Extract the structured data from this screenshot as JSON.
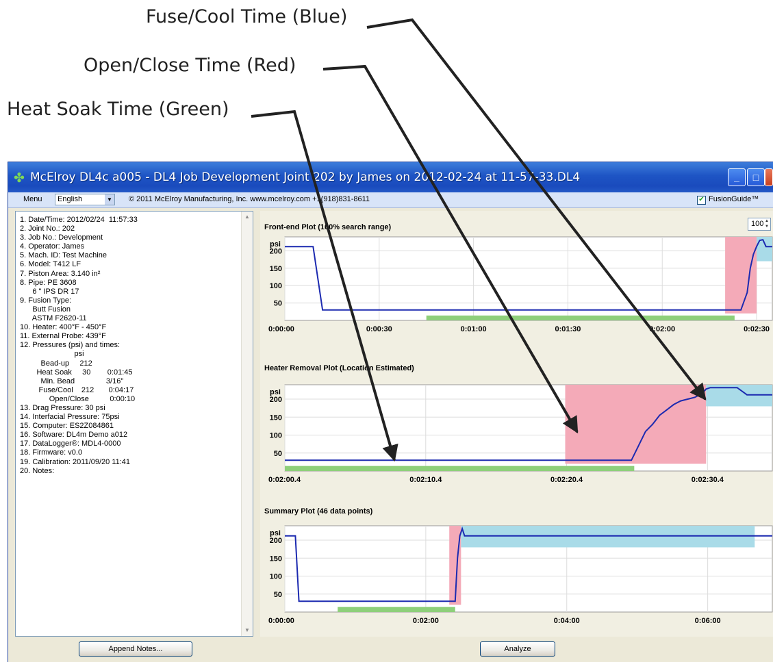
{
  "annotations": {
    "fuse_cool": "Fuse/Cool Time (Blue)",
    "open_close": "Open/Close Time (Red)",
    "heat_soak": "Heat Soak Time (Green)"
  },
  "window": {
    "title": "McElroy DL4c a005 - DL4 Job Development Joint 202 by James on 2012-02-24 at 11-57-33.DL4",
    "buttons": {
      "minimize": "_",
      "maximize": "□",
      "close": "✕"
    }
  },
  "menubar": {
    "menu_label": "Menu",
    "language": "English",
    "copyright": "© 2011 McElroy Manufacturing, Inc.  www.mcelroy.com  +1(918)831-8611",
    "fusionguide_label": "FusionGuide™",
    "fusionguide_checked": true
  },
  "info": [
    "1. Date/Time: 2012/02/24  11:57:33",
    "2. Joint No.: 202",
    "3. Job No.: Development",
    "4. Operator: James",
    "5. Mach. ID: Test Machine",
    "6. Model: T412 LF",
    "7. Piston Area: 3.140 in²",
    "8. Pipe: PE 3608",
    "      6 \" IPS DR 17",
    "9. Fusion Type:",
    "      Butt Fusion",
    "      ASTM F2620-11",
    "10. Heater: 400°F - 450°F",
    "11. External Probe: 439°F",
    "12. Pressures (psi) and times:",
    "                          psi",
    "          Bead-up     212",
    "        Heat Soak     30        0:01:45",
    "          Min. Bead               3/16\"",
    "         Fuse/Cool    212       0:04:17",
    "              Open/Close          0:00:10",
    "13. Drag Pressure: 30 psi",
    "14. Interfacial Pressure: 75psi",
    "15. Computer: ES2Z084861",
    "16. Software: DL4m Demo a012",
    "17. DataLogger®: MDL4-0000",
    "18. Firmware: v0.0",
    "19. Calibration: 2011/09/20 11:41",
    "20. Notes:"
  ],
  "zoom": {
    "value": "100",
    "arrows": "▲▼"
  },
  "scroll": {
    "up": "▲",
    "down": "▼"
  },
  "buttons": {
    "append_notes": "Append Notes...",
    "analyze": "Analyze"
  },
  "chart_data": [
    {
      "type": "line",
      "title": "Front-end Plot (100% search range)",
      "ylabel": "psi",
      "yticks": [
        50,
        100,
        150,
        200
      ],
      "ylim": [
        0,
        240
      ],
      "x_ticks": [
        "0:00:00",
        "0:00:30",
        "0:01:00",
        "0:01:30",
        "0:02:00",
        "0:02:30"
      ],
      "x_tick_seconds": [
        0,
        30,
        60,
        90,
        120,
        150
      ],
      "xlim_seconds": [
        0,
        155
      ],
      "series": [
        {
          "color": "#1c2ab0",
          "x_seconds": [
            0,
            9,
            12,
            145,
            147,
            148,
            149,
            150,
            151,
            152,
            153,
            155
          ],
          "values": [
            212,
            212,
            30,
            30,
            80,
            150,
            190,
            212,
            230,
            232,
            212,
            212
          ]
        }
      ],
      "regions": [
        {
          "color": "#8ecf7a",
          "start_seconds": 45,
          "end_seconds": 143,
          "low": 0,
          "high": 14
        },
        {
          "color": "#f4aab8",
          "start_seconds": 140,
          "end_seconds": 150,
          "low": 20,
          "high": 240
        },
        {
          "color": "#a9dbe8",
          "start_seconds": 150,
          "end_seconds": 155,
          "low": 170,
          "high": 240
        }
      ]
    },
    {
      "type": "line",
      "title": "Heater Removal Plot (Location Estimated)",
      "ylabel": "psi",
      "yticks": [
        50,
        100,
        150,
        200
      ],
      "ylim": [
        0,
        240
      ],
      "x_ticks": [
        "0:02:00.4",
        "0:02:10.4",
        "0:02:20.4",
        "0:02:30.4"
      ],
      "x_tick_seconds": [
        120.4,
        130.4,
        140.4,
        150.4
      ],
      "xlim_seconds": [
        120.4,
        155
      ],
      "series": [
        {
          "color": "#1c2ab0",
          "x_seconds": [
            120.4,
            145.0,
            145.5,
            146.0,
            146.5,
            147.0,
            147.5,
            148.0,
            148.5,
            149.0,
            149.5,
            150.0,
            150.3,
            150.6,
            152.5,
            153.2,
            155.0
          ],
          "values": [
            30,
            30,
            70,
            110,
            130,
            155,
            170,
            185,
            195,
            200,
            205,
            215,
            228,
            232,
            232,
            212,
            212
          ]
        }
      ],
      "regions": [
        {
          "color": "#8ecf7a",
          "start_seconds": 120.4,
          "end_seconds": 145.2,
          "low": 0,
          "high": 14
        },
        {
          "color": "#f4aab8",
          "start_seconds": 140.3,
          "end_seconds": 150.3,
          "low": 20,
          "high": 240
        },
        {
          "color": "#a9dbe8",
          "start_seconds": 150.3,
          "end_seconds": 155,
          "low": 180,
          "high": 240
        }
      ]
    },
    {
      "type": "line",
      "title": "Summary Plot (46 data points)",
      "ylabel": "psi",
      "yticks": [
        50,
        100,
        150,
        200
      ],
      "ylim": [
        0,
        240
      ],
      "x_ticks": [
        "0:00:00",
        "0:02:00",
        "0:04:00",
        "0:06:00"
      ],
      "x_tick_seconds": [
        0,
        120,
        240,
        360
      ],
      "xlim_seconds": [
        0,
        415
      ],
      "series": [
        {
          "color": "#1c2ab0",
          "x_seconds": [
            0,
            9,
            12,
            145,
            147,
            149,
            151,
            153,
            160,
            415
          ],
          "values": [
            212,
            212,
            30,
            30,
            150,
            212,
            232,
            212,
            212,
            212
          ]
        }
      ],
      "regions": [
        {
          "color": "#8ecf7a",
          "start_seconds": 45,
          "end_seconds": 145,
          "low": 0,
          "high": 14
        },
        {
          "color": "#f4aab8",
          "start_seconds": 140,
          "end_seconds": 150,
          "low": 20,
          "high": 240
        },
        {
          "color": "#a9dbe8",
          "start_seconds": 150,
          "end_seconds": 400,
          "low": 180,
          "high": 240
        }
      ]
    }
  ]
}
